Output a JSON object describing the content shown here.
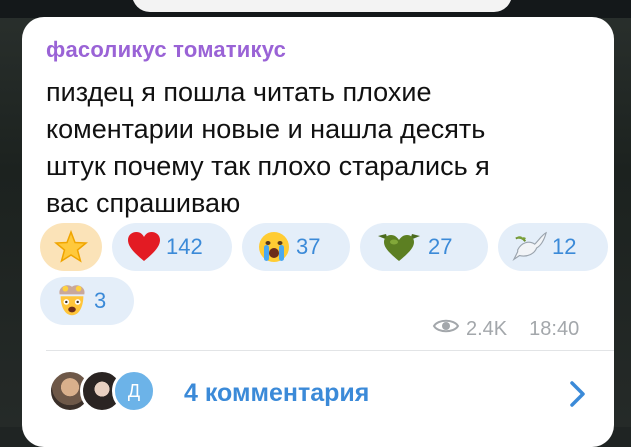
{
  "message": {
    "sender": "фасоликус томатикус",
    "text": "пиздец я пошла читать плохие\nкоментарии новые и нашла десять\nштук почему так плохо старались я\nвас спрашиваю"
  },
  "reactions": [
    {
      "emoji": "star-icon",
      "count": ""
    },
    {
      "emoji": "red-heart-icon",
      "count": "142"
    },
    {
      "emoji": "crying-face-icon",
      "count": "37"
    },
    {
      "emoji": "green-heart-icon",
      "count": "27"
    },
    {
      "emoji": "dove-icon",
      "count": "12"
    },
    {
      "emoji": "exploding-head-icon",
      "count": "3"
    }
  ],
  "meta": {
    "views": "2.4K",
    "time": "18:40"
  },
  "comments": {
    "label": "4 комментария",
    "avatar_letter": "Д"
  },
  "colors": {
    "sender": "#9a63d6",
    "link": "#3b8ad8",
    "chip": "#e4eef9",
    "chip_active": "#fbe3b8"
  }
}
